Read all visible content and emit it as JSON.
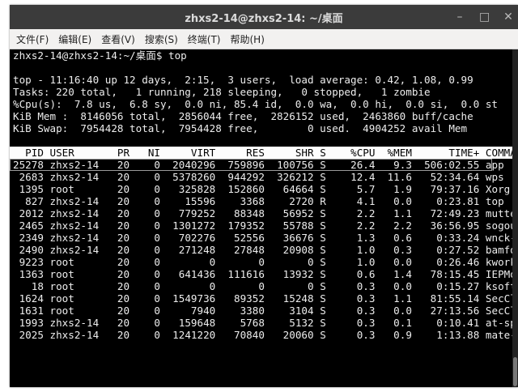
{
  "window": {
    "title": "zhxs2-14@zhxs2-14: ~/桌面",
    "minimize": "–",
    "maximize": "□",
    "close": "✕"
  },
  "menu": [
    "文件(F)",
    "编辑(E)",
    "查看(V)",
    "搜索(S)",
    "终端(T)",
    "帮助(H)"
  ],
  "prompt": "zhxs2-14@zhxs2-14:~/桌面$ top",
  "summary": [
    "top - 11:16:40 up 12 days,  2:15,  3 users,  load average: 0.42, 1.08, 0.99",
    "Tasks: 220 total,   1 running, 218 sleeping,   0 stopped,   1 zombie",
    "%Cpu(s):  7.8 us,  6.8 sy,  0.0 ni, 85.4 id,  0.0 wa,  0.0 hi,  0.0 si,  0.0 st",
    "KiB Mem :  8146056 total,  2856044 free,  2826152 used,  2463860 buff/cache",
    "KiB Swap:  7954428 total,  7954428 free,        0 used.  4904252 avail Mem"
  ],
  "columns": [
    "PID",
    "USER",
    "PR",
    "NI",
    "VIRT",
    "RES",
    "SHR",
    "S",
    "%CPU",
    "%MEM",
    "TIME+",
    "COMMAND"
  ],
  "processes": [
    [
      "25278",
      "zhxs2-14",
      "20",
      "0",
      "2040296",
      "759896",
      "100756",
      "S",
      "26.4",
      "9.3",
      "506:02.55",
      "app"
    ],
    [
      "2683",
      "zhxs2-14",
      "20",
      "0",
      "5378260",
      "944292",
      "326212",
      "S",
      "12.4",
      "11.6",
      "52:34.64",
      "wps"
    ],
    [
      "1395",
      "root",
      "20",
      "0",
      "325828",
      "152860",
      "64664",
      "S",
      "5.7",
      "1.9",
      "79:37.16",
      "Xorg"
    ],
    [
      "827",
      "zhxs2-14",
      "20",
      "0",
      "15596",
      "3368",
      "2720",
      "R",
      "4.1",
      "0.0",
      "0:23.81",
      "top"
    ],
    [
      "2012",
      "zhxs2-14",
      "20",
      "0",
      "779252",
      "88348",
      "56952",
      "S",
      "2.2",
      "1.1",
      "72:49.23",
      "mutter"
    ],
    [
      "2465",
      "zhxs2-14",
      "20",
      "0",
      "1301272",
      "179352",
      "55788",
      "S",
      "2.2",
      "2.2",
      "36:56.95",
      "sogou-qimp+"
    ],
    [
      "2349",
      "zhxs2-14",
      "20",
      "0",
      "702276",
      "52556",
      "36676",
      "S",
      "1.3",
      "0.6",
      "0:33.24",
      "wnck-applet"
    ],
    [
      "2490",
      "zhxs2-14",
      "20",
      "0",
      "271248",
      "27848",
      "20908",
      "S",
      "1.0",
      "0.3",
      "0:27.52",
      "bamfdaemon"
    ],
    [
      "9223",
      "root",
      "20",
      "0",
      "0",
      "0",
      "0",
      "S",
      "1.0",
      "0.0",
      "0:26.46",
      "kworker/1:1"
    ],
    [
      "1363",
      "root",
      "20",
      "0",
      "641436",
      "111616",
      "13932",
      "S",
      "0.6",
      "1.4",
      "78:15.45",
      "IEPMonitor"
    ],
    [
      "18",
      "root",
      "20",
      "0",
      "0",
      "0",
      "0",
      "S",
      "0.3",
      "0.0",
      "0:15.27",
      "ksoftirqd/2"
    ],
    [
      "1624",
      "root",
      "20",
      "0",
      "1549736",
      "89352",
      "15248",
      "S",
      "0.3",
      "1.1",
      "81:55.14",
      "SecClientA+"
    ],
    [
      "1631",
      "root",
      "20",
      "0",
      "7940",
      "3380",
      "3104",
      "S",
      "0.3",
      "0.0",
      "27:13.56",
      "SecClientP+"
    ],
    [
      "1993",
      "zhxs2-14",
      "20",
      "0",
      "159648",
      "5768",
      "5132",
      "S",
      "0.3",
      "0.1",
      "0:10.41",
      "at-spi2-re+"
    ],
    [
      "2025",
      "zhxs2-14",
      "20",
      "0",
      "1241220",
      "70840",
      "20060",
      "S",
      "0.3",
      "0.9",
      "1:13.88",
      "mate-setti+"
    ]
  ]
}
